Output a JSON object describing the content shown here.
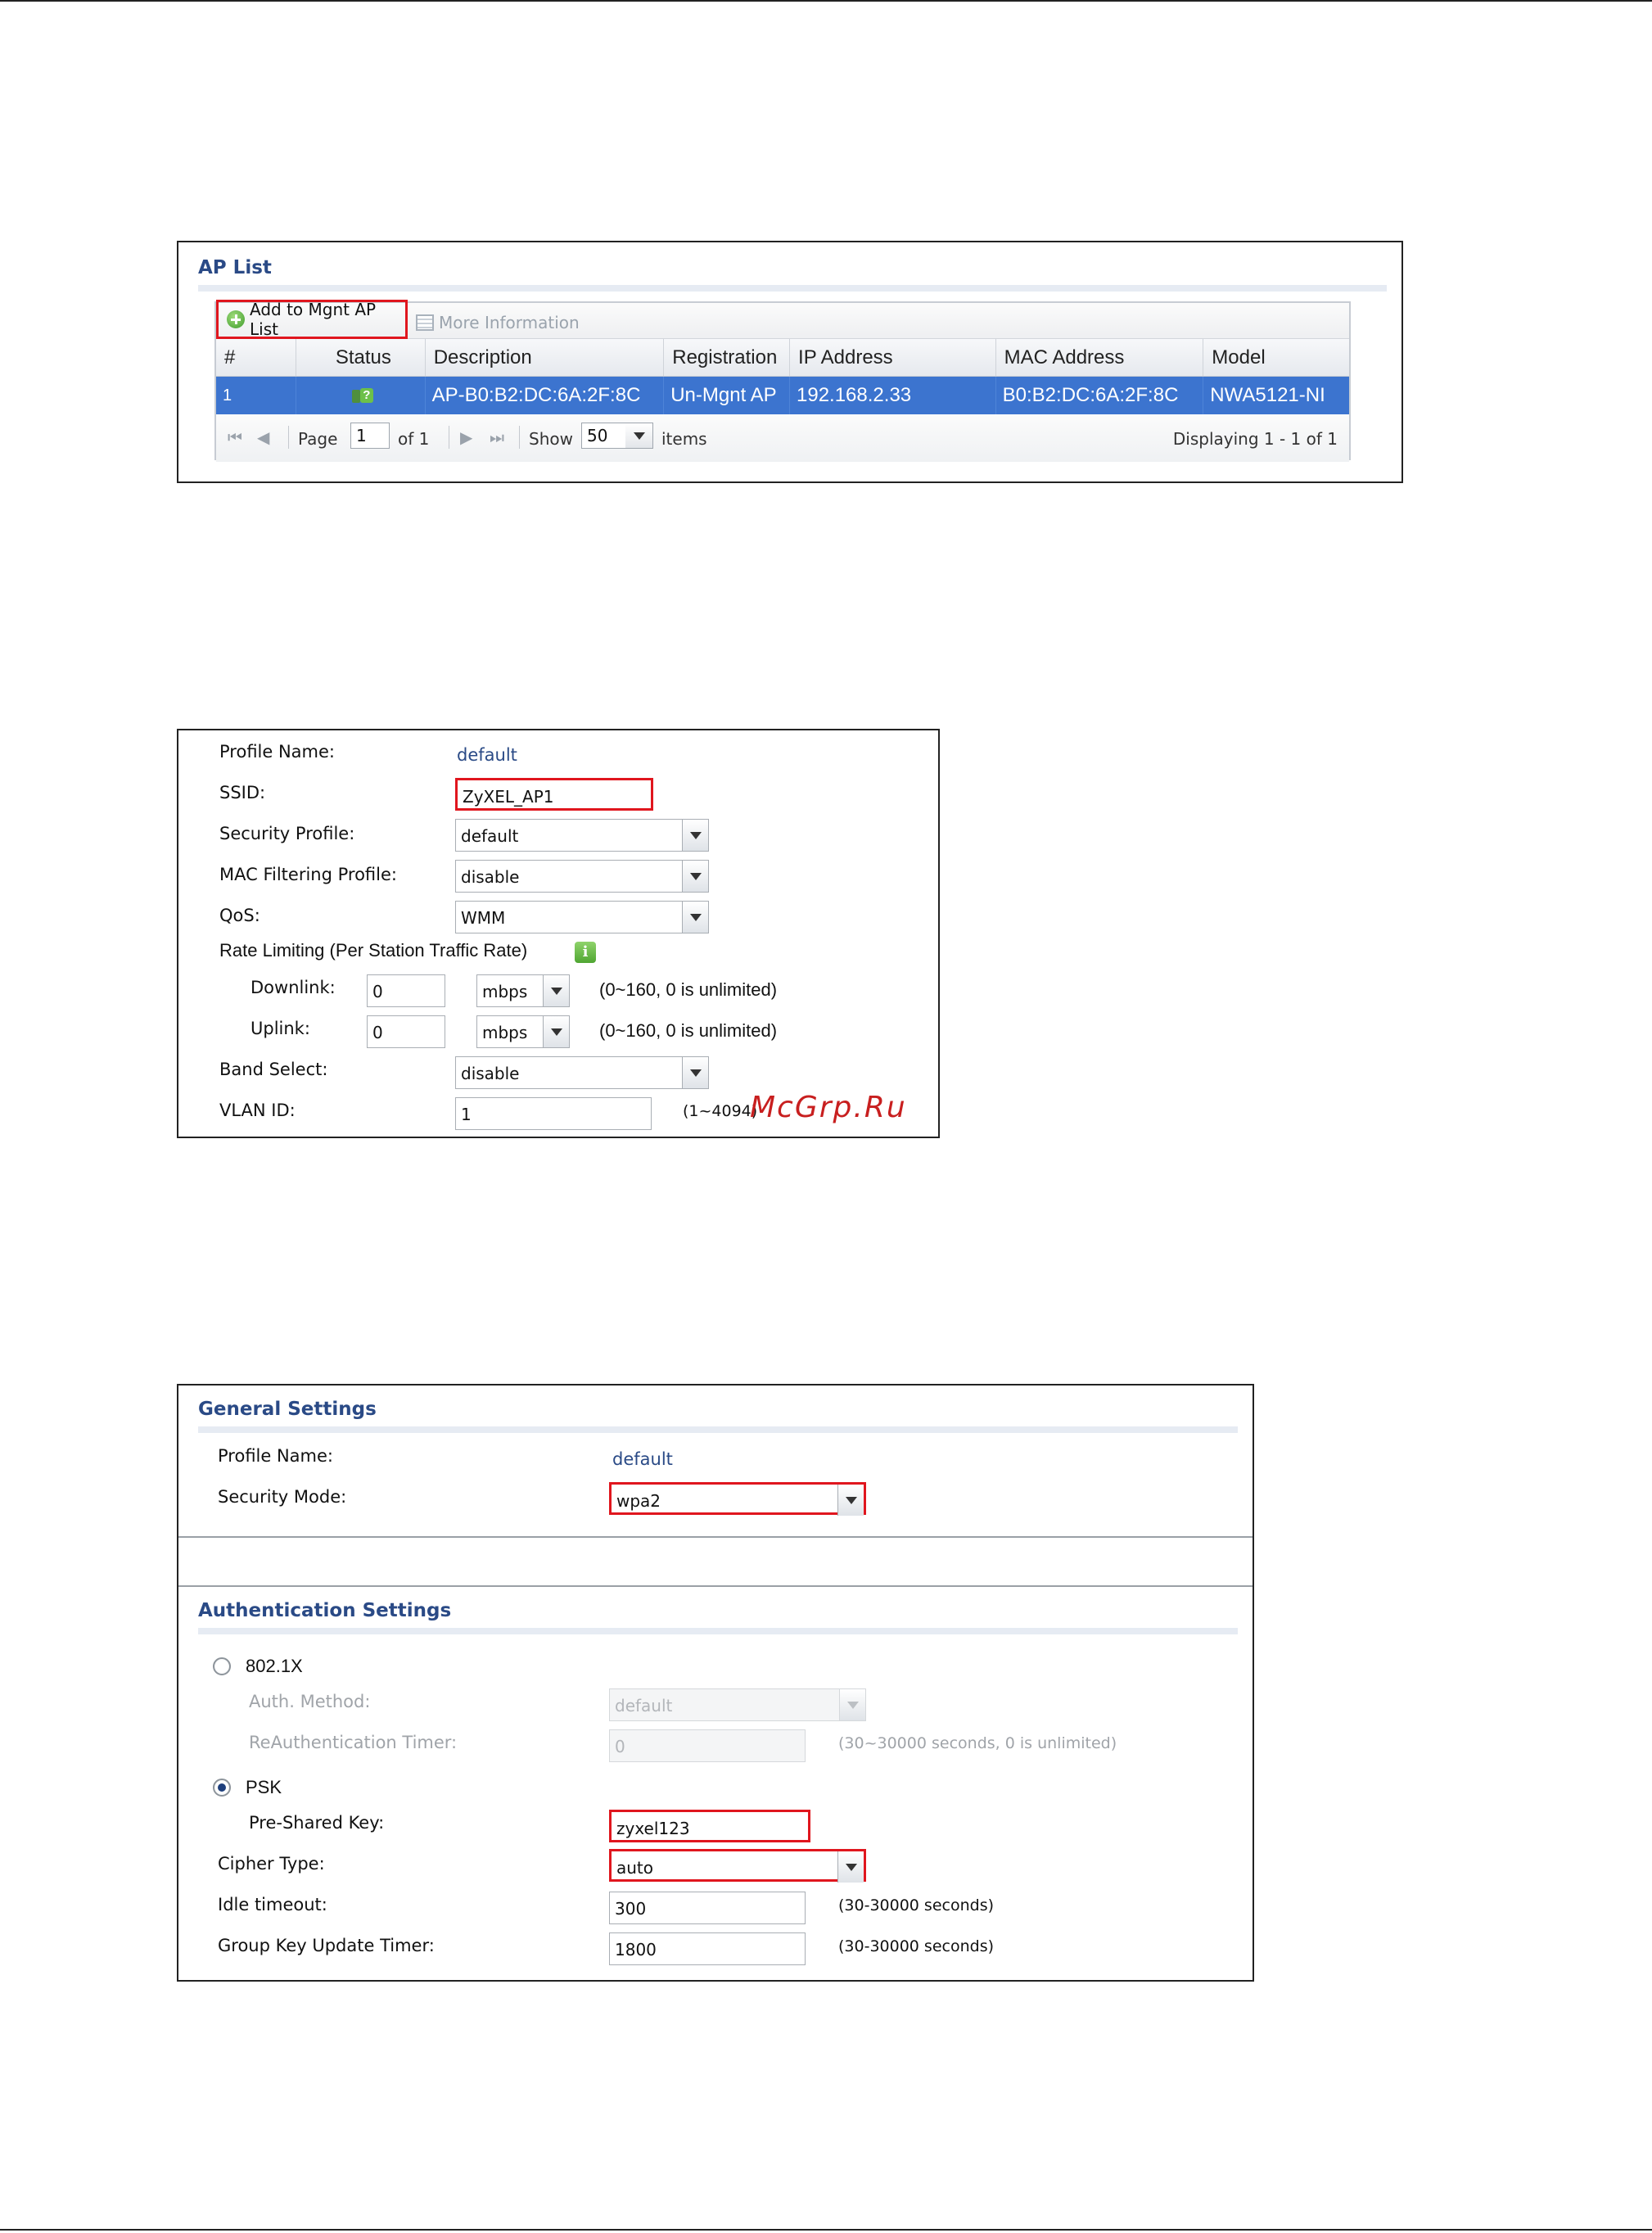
{
  "ap_list": {
    "title": "AP List",
    "toolbar": {
      "add_label": "Add to Mgnt AP List",
      "more_label": "More Information"
    },
    "columns": [
      "#",
      "Status",
      "Description",
      "Registration",
      "IP Address",
      "MAC Address",
      "Model"
    ],
    "rows": [
      {
        "index": "1",
        "status_icon": "ap-unknown-status-icon",
        "description": "AP-B0:B2:DC:6A:2F:8C",
        "registration": "Un-Mgnt AP",
        "ip": "192.168.2.33",
        "mac": "B0:B2:DC:6A:2F:8C",
        "model": "NWA5121-NI"
      }
    ],
    "pager": {
      "page_label": "Page",
      "page_value": "1",
      "of_label": "of 1",
      "show_label": "Show",
      "show_value": "50",
      "items_label": "items",
      "displaying": "Displaying 1 - 1 of 1"
    }
  },
  "ssid_profile": {
    "profile_name_label": "Profile Name:",
    "profile_name_value": "default",
    "ssid_label": "SSID:",
    "ssid_value": "ZyXEL_AP1",
    "security_profile_label": "Security Profile:",
    "security_profile_value": "default",
    "mac_filter_label": "MAC Filtering Profile:",
    "mac_filter_value": "disable",
    "qos_label": "QoS:",
    "qos_value": "WMM",
    "rate_limit_label": "Rate Limiting (Per Station Traffic Rate)",
    "downlink_label": "Downlink:",
    "downlink_value": "0",
    "downlink_unit": "mbps",
    "downlink_hint": "(0~160, 0 is unlimited)",
    "uplink_label": "Uplink:",
    "uplink_value": "0",
    "uplink_unit": "mbps",
    "uplink_hint": "(0~160, 0 is unlimited)",
    "band_select_label": "Band Select:",
    "band_select_value": "disable",
    "vlan_label": "VLAN ID:",
    "vlan_value": "1",
    "vlan_hint": "(1~4094)",
    "watermark": "McGrp.Ru"
  },
  "security_profile": {
    "general_title": "General Settings",
    "profile_name_label": "Profile Name:",
    "profile_name_value": "default",
    "security_mode_label": "Security Mode:",
    "security_mode_value": "wpa2",
    "auth_title": "Authentication Settings",
    "radio_8021x_label": "802.1X",
    "auth_method_label": "Auth. Method:",
    "auth_method_value": "default",
    "reauth_label": "ReAuthentication Timer:",
    "reauth_value": "0",
    "reauth_hint": "(30~30000 seconds, 0 is unlimited)",
    "radio_psk_label": "PSK",
    "psk_label": "Pre-Shared Key:",
    "psk_value": "zyxel123",
    "cipher_label": "Cipher Type:",
    "cipher_value": "auto",
    "idle_label": "Idle timeout:",
    "idle_value": "300",
    "idle_hint": "(30-30000 seconds)",
    "gkut_label": "Group Key Update Timer:",
    "gkut_value": "1800",
    "gkut_hint": "(30-30000 seconds)"
  },
  "colors": {
    "accent_blue": "#2a4a86",
    "selected_row": "#3c74cf",
    "highlight_red": "#e0161e"
  }
}
